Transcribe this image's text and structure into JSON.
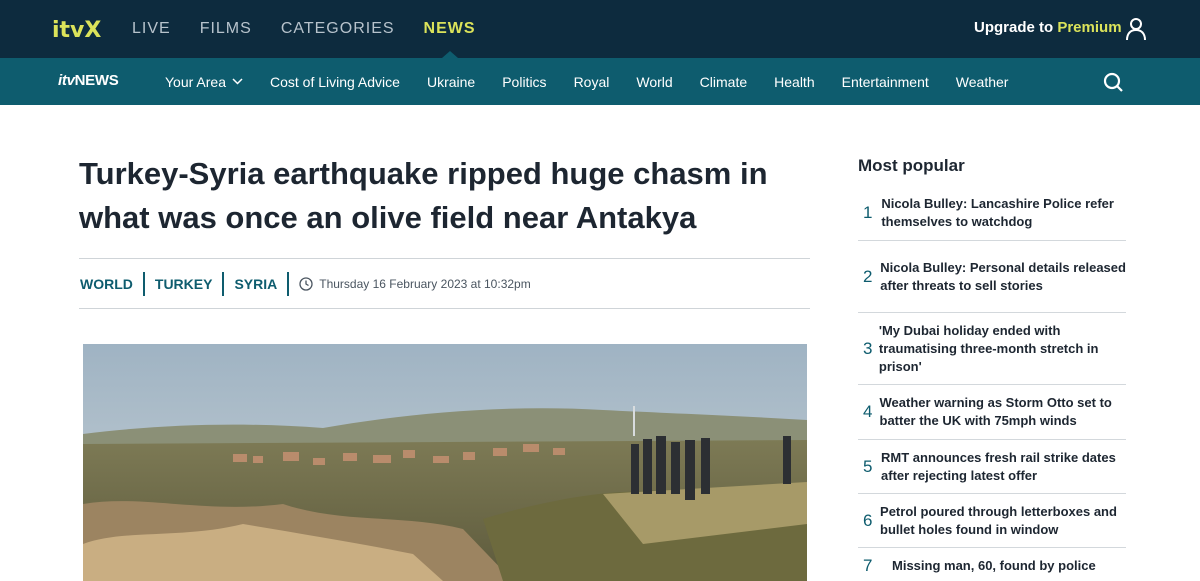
{
  "top_nav": {
    "logo": "itvX",
    "items": [
      {
        "label": "LIVE"
      },
      {
        "label": "FILMS"
      },
      {
        "label": "CATEGORIES"
      },
      {
        "label": "NEWS",
        "active": true
      }
    ],
    "upgrade_prefix": "Upgrade to",
    "upgrade_highlight": "Premium",
    "colors": {
      "background": "#0d2b3e",
      "accent": "#dbe35a"
    }
  },
  "sub_nav": {
    "logo_itv": "itv",
    "logo_news": "NEWS",
    "items": [
      {
        "label": "Your Area",
        "has_dropdown": true
      },
      {
        "label": "Cost of Living Advice"
      },
      {
        "label": "Ukraine"
      },
      {
        "label": "Politics"
      },
      {
        "label": "Royal"
      },
      {
        "label": "World"
      },
      {
        "label": "Climate"
      },
      {
        "label": "Health"
      },
      {
        "label": "Entertainment"
      },
      {
        "label": "Weather"
      }
    ],
    "colors": {
      "background": "#0e5c6e"
    }
  },
  "article": {
    "headline": "Turkey-Syria earthquake ripped huge chasm in what was once an olive field near Antakya",
    "tags": [
      "WORLD",
      "TURKEY",
      "SYRIA"
    ],
    "date": "Thursday 16 February 2023 at 10:32pm"
  },
  "most_popular": {
    "title": "Most popular",
    "items": [
      {
        "num": "1",
        "text": "Nicola Bulley: Lancashire Police refer themselves to watchdog"
      },
      {
        "num": "2",
        "text": "Nicola Bulley: Personal details released after threats to sell stories"
      },
      {
        "num": "3",
        "text": "'My Dubai holiday ended with traumatising three-month stretch in prison'"
      },
      {
        "num": "4",
        "text": "Weather warning as Storm Otto set to batter the UK with 75mph winds"
      },
      {
        "num": "5",
        "text": "RMT announces fresh rail strike dates after rejecting latest offer"
      },
      {
        "num": "6",
        "text": "Petrol poured through letterboxes and bullet holes found in window"
      },
      {
        "num": "7",
        "text": "Missing man, 60, found by police"
      }
    ]
  }
}
